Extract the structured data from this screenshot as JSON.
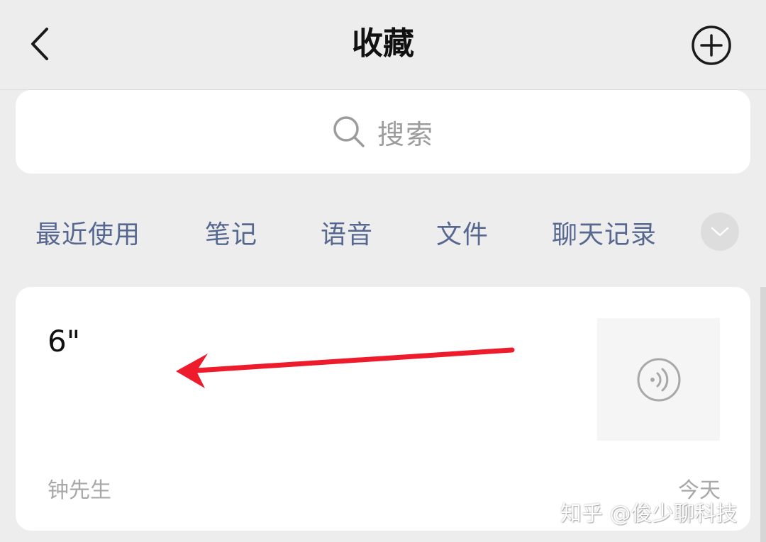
{
  "header": {
    "title": "收藏",
    "back_icon": "chevron-left-icon",
    "add_icon": "plus-circle-icon"
  },
  "search": {
    "placeholder": "搜索",
    "icon": "search-icon"
  },
  "tabs": [
    {
      "label": "最近使用"
    },
    {
      "label": "笔记"
    },
    {
      "label": "语音"
    },
    {
      "label": "文件"
    },
    {
      "label": "聊天记录"
    }
  ],
  "tabs_expand_icon": "chevron-down-icon",
  "favorites": [
    {
      "content": "6\"",
      "type_icon": "voice-icon",
      "author": "钟先生",
      "date": "今天"
    }
  ],
  "watermark": "知乎 @俊少聊科技",
  "colors": {
    "background": "#ededed",
    "card": "#ffffff",
    "tab_text": "#56688f",
    "secondary_text": "#a8a8a8",
    "annotation_arrow": "#ee1b2c"
  }
}
